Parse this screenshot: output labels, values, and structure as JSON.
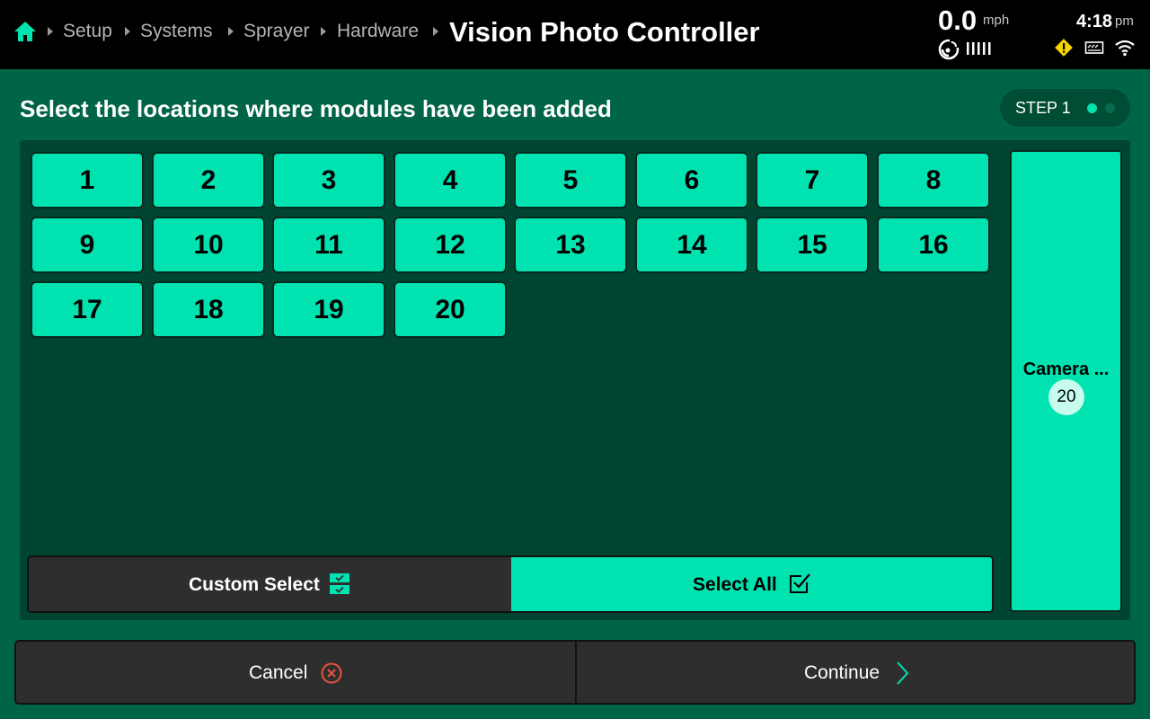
{
  "header": {
    "breadcrumbs": [
      "Setup",
      "Systems",
      "Sprayer",
      "Hardware"
    ],
    "title": "Vision Photo Controller",
    "speed_value": "0.0",
    "speed_unit": "mph",
    "time": "4:18",
    "time_ampm": "pm",
    "icons": [
      "home-icon",
      "gps-signal-icon",
      "signal-bars-icon",
      "warning-icon",
      "implement-icon",
      "wifi-icon"
    ]
  },
  "instruction": "Select the locations where modules have been added",
  "step": {
    "label": "STEP 1",
    "current": 1,
    "total": 2
  },
  "locations": [
    "1",
    "2",
    "3",
    "4",
    "5",
    "6",
    "7",
    "8",
    "9",
    "10",
    "11",
    "12",
    "13",
    "14",
    "15",
    "16",
    "17",
    "18",
    "19",
    "20"
  ],
  "selection_mode": {
    "custom_label": "Custom Select",
    "select_all_label": "Select All",
    "selected": "Select All"
  },
  "camera": {
    "label": "Camera ...",
    "count": "20"
  },
  "footer": {
    "cancel_label": "Cancel",
    "continue_label": "Continue"
  },
  "colors": {
    "background": "#006446",
    "panel": "#004532",
    "accent": "#00e3b1",
    "topbar": "#000000",
    "button_dark": "#2e2e2e",
    "cancel_icon": "#e8523f",
    "warning": "#f5d400"
  }
}
